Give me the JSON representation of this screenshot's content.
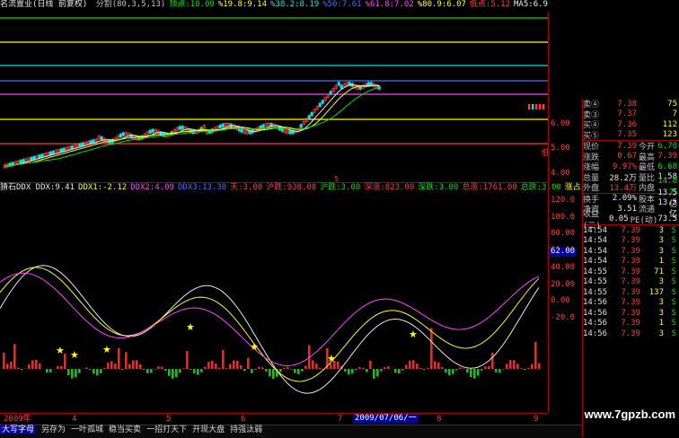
{
  "topbar": {
    "title": "名流置业(日线 前复权)",
    "items": [
      {
        "text": "分割(80,3,5,13)",
        "color": "#c0c0c0"
      },
      {
        "text": "顶点:10.09",
        "color": "#00e000"
      },
      {
        "text": "%19.8:9.14",
        "color": "#ffff00"
      },
      {
        "text": "%38.2:8.19",
        "color": "#00e8e8"
      },
      {
        "text": "%50:7.61",
        "color": "#4a6cff"
      },
      {
        "text": "%61.8:7.02",
        "color": "#ff40ff"
      },
      {
        "text": "%80.9:6.07",
        "color": "#ffff00"
      },
      {
        "text": "低点:5.12",
        "color": "#ff3b3b"
      },
      {
        "text": "MA5:6.9",
        "color": "#e8e8e8"
      }
    ]
  },
  "main_axis": {
    "ticks": [
      "6.00",
      "5.00",
      "4.00"
    ]
  },
  "main_labels": {
    "low": "低",
    "top_small": "5"
  },
  "ind_bar": {
    "items": [
      {
        "text": "猜石DDX DDX:9.41",
        "color": "#e8e8e8"
      },
      {
        "text": "DDX1:-2.12",
        "color": "#ffff00"
      },
      {
        "text": "DDX2:4.09",
        "color": "#ff40ff"
      },
      {
        "text": "DDX3:13.30",
        "color": "#4a6cff"
      },
      {
        "text": "天:3.00",
        "color": "#ff3b3b"
      },
      {
        "text": "沪跌:938.00",
        "color": "#ff3b3b"
      },
      {
        "text": "沪跌:3.00",
        "color": "#00e000"
      },
      {
        "text": "深涨:823.00",
        "color": "#ff3b3b"
      },
      {
        "text": "深跌:3.00",
        "color": "#00e000"
      },
      {
        "text": "总涨:1761.00",
        "color": "#ff3b3b"
      },
      {
        "text": "总跌:3.00",
        "color": "#00e000"
      },
      {
        "text": "涨占比%:99.83",
        "color": "#ffff00"
      }
    ]
  },
  "ind_axis": {
    "ticks": [
      "120.0",
      "100.0",
      "80.00",
      "60.00",
      "40.00",
      "20.00",
      "0.00",
      "-20.0"
    ],
    "highlight": "62.00"
  },
  "dates": {
    "start": "2009年",
    "marks": [
      "4",
      "5",
      "6",
      "7",
      "8",
      "9"
    ],
    "current": "2009/07/06/一"
  },
  "toolbar": {
    "items": [
      "大写字母",
      "另存为",
      "一叶孤城",
      "稳当买卖",
      "一招打天下",
      "开现大盘",
      "持强汰弱"
    ]
  },
  "quote": {
    "asks": [
      {
        "label": "卖④",
        "price": "7.38",
        "vol": "75"
      },
      {
        "label": "卖③",
        "price": "7.37",
        "vol": "7"
      },
      {
        "label": "买④",
        "price": "7.36",
        "vol": "112"
      },
      {
        "label": "买⑤",
        "price": "7.35",
        "vol": "123"
      }
    ],
    "stats": [
      {
        "l1": "现价",
        "v1": "7.39",
        "c1": "red",
        "l2": "今开",
        "v2": "6.70",
        "c2": "grn"
      },
      {
        "l1": "涨跌",
        "v1": "0.67",
        "c1": "red",
        "l2": "最高",
        "v2": "7.39",
        "c2": "red"
      },
      {
        "l1": "涨幅",
        "v1": "9.97%",
        "c1": "red",
        "l2": "最低",
        "v2": "6.68",
        "c2": "grn"
      },
      {
        "l1": "总量",
        "v1": "28.2万",
        "c1": "wht",
        "l2": "量比",
        "v2": "1.58",
        "c2": "wht"
      },
      {
        "l1": "外盘",
        "v1": "13.4万",
        "c1": "red",
        "l2": "内盘",
        "v2": "14.8万",
        "c2": "grn"
      },
      {
        "l1": "换手",
        "v1": "2.09%",
        "c1": "wht",
        "l2": "股本",
        "v2": "13.5亿",
        "c2": "wht"
      },
      {
        "l1": "净资",
        "v1": "3.51",
        "c1": "wht",
        "l2": "流通",
        "v2": "13.5亿",
        "c2": "wht"
      },
      {
        "l1": "收益(二)",
        "v1": "0.05",
        "c1": "wht",
        "l2": "PE(动)",
        "v2": "73.5",
        "c2": "wht"
      }
    ],
    "ticks": [
      {
        "time": "14:54",
        "price": "7.39",
        "vol": "3",
        "dir": "S"
      },
      {
        "time": "14:54",
        "price": "7.39",
        "vol": "3",
        "dir": "S"
      },
      {
        "time": "14:54",
        "price": "7.39",
        "vol": "3",
        "dir": "S"
      },
      {
        "time": "14:54",
        "price": "7.39",
        "vol": "1",
        "dir": "S"
      },
      {
        "time": "14:55",
        "price": "7.39",
        "vol": "71",
        "dir": "S"
      },
      {
        "time": "14:55",
        "price": "7.39",
        "vol": "3",
        "dir": "S"
      },
      {
        "time": "14:55",
        "price": "7.39",
        "vol": "137",
        "dir": "S"
      },
      {
        "time": "14:56",
        "price": "7.39",
        "vol": "3",
        "dir": "S"
      },
      {
        "time": "14:56",
        "price": "7.39",
        "vol": "3",
        "dir": "S"
      },
      {
        "time": "14:56",
        "price": "7.39",
        "vol": "1",
        "dir": "S"
      },
      {
        "time": "14:56",
        "price": "7.39",
        "vol": "3",
        "dir": "S"
      }
    ]
  },
  "watermark": "www.7gpzb.com"
}
